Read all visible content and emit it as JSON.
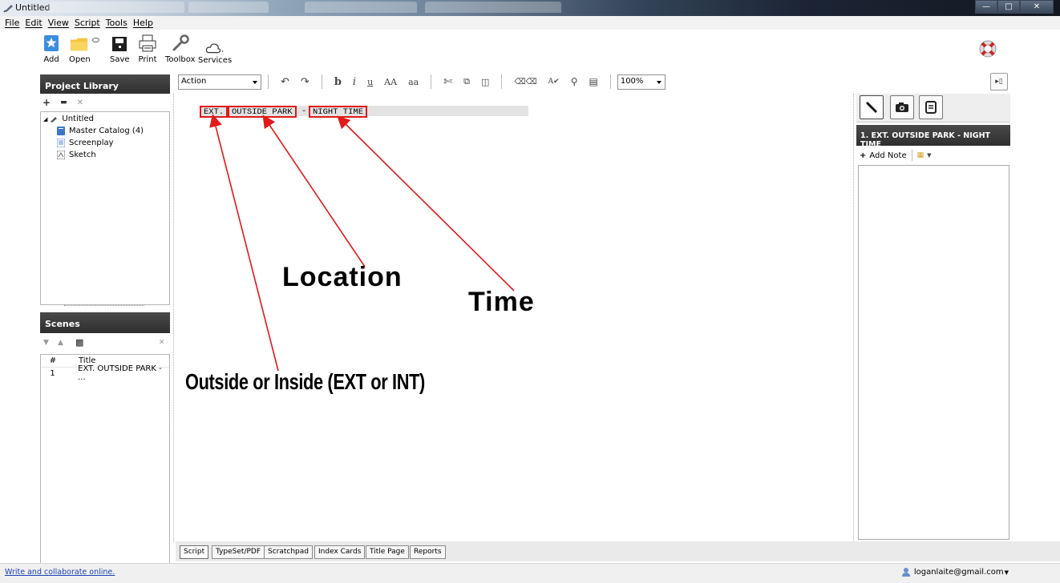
{
  "window": {
    "title": "Untitled"
  },
  "menu": [
    "File",
    "Edit",
    "View",
    "Script",
    "Tools",
    "Help"
  ],
  "toolbar": {
    "add": "Add",
    "open": "Open",
    "save": "Save",
    "print": "Print",
    "toolbox": "Toolbox",
    "services": "Services"
  },
  "library": {
    "title": "Project Library",
    "root": "Untitled",
    "items": [
      "Master Catalog (4)",
      "Screenplay",
      "Sketch"
    ]
  },
  "scenes": {
    "title": "Scenes",
    "columns": [
      "#",
      "Title"
    ],
    "rows": [
      {
        "num": "1",
        "title": "EXT. OUTSIDE PARK - ..."
      }
    ]
  },
  "format": {
    "element_type": "Action",
    "zoom": "100%"
  },
  "script": {
    "slug_int_ext": "EXT.",
    "slug_location": "OUTSIDE PARK",
    "slug_separator": "-",
    "slug_time": "NIGHT TIME"
  },
  "annotations": {
    "location": "Location",
    "time": "Time",
    "int_ext": "Outside or Inside (EXT or INT)",
    "color": "#e01a1a"
  },
  "notes_panel": {
    "scene_title": "1. EXT. OUTSIDE PARK - NIGHT TIME",
    "add_note": "Add Note"
  },
  "bottom_tabs": [
    "Script",
    "TypeSet/PDF",
    "Scratchpad",
    "Index Cards",
    "Title Page",
    "Reports"
  ],
  "status": {
    "link": "Write and collaborate online.",
    "user": "loganlaite@gmail.com"
  }
}
